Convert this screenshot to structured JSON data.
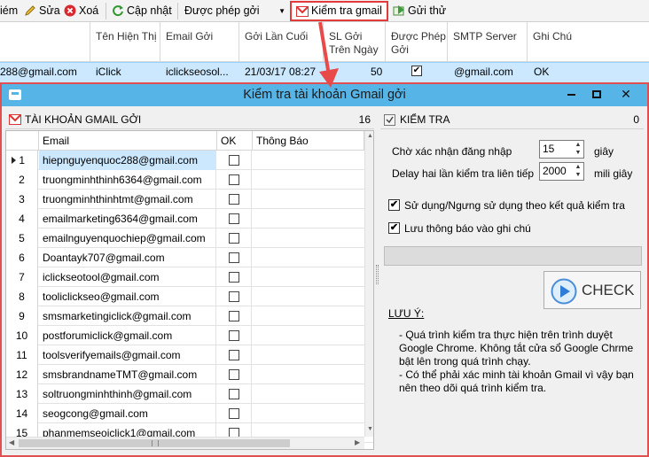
{
  "toolbar": {
    "add_label": "iém",
    "edit_label": "Sửa",
    "delete_label": "Xoá",
    "update_label": "Cập nhật",
    "filter_value": "Được phép gởi",
    "check_gmail_label": "Kiểm tra gmail",
    "send_test_label": "Gửi thử"
  },
  "bg_table": {
    "headers": [
      "Tên Hiện Thị",
      "Email Gởi",
      "Gởi Lần Cuối",
      "SL Gởi Trên Ngày",
      "Được Phép Gởi",
      "SMTP Server",
      "Ghi Chú"
    ],
    "row": {
      "email_partial": "288@gmail.com",
      "name": "iClick",
      "sender": "iclickseosol...",
      "last_sent": "21/03/17 08:27",
      "per_day": "50",
      "allowed": true,
      "smtp": "@gmail.com",
      "note": "OK"
    }
  },
  "dialog": {
    "title": "Kiểm tra tài khoản Gmail gởi",
    "left": {
      "title": "TÀI KHOẢN GMAIL GỞI",
      "count": "16",
      "columns": [
        "Email",
        "OK",
        "Thông Báo"
      ],
      "rows": [
        {
          "n": "1",
          "email": "hiepnguyenquoc288@gmail.com"
        },
        {
          "n": "2",
          "email": "truongminhthinh6364@gmail.com"
        },
        {
          "n": "3",
          "email": "truongminhthinhtmt@gmail.com"
        },
        {
          "n": "4",
          "email": "emailmarketing6364@gmail.com"
        },
        {
          "n": "5",
          "email": "emailnguyenquochiep@gmail.com"
        },
        {
          "n": "6",
          "email": "Doantayk707@gmail.com"
        },
        {
          "n": "7",
          "email": "iclickseotool@gmail.com"
        },
        {
          "n": "8",
          "email": "tooliclickseo@gmail.com"
        },
        {
          "n": "9",
          "email": "smsmarketingiclick@gmail.com"
        },
        {
          "n": "10",
          "email": "postforumiclick@gmail.com"
        },
        {
          "n": "11",
          "email": "toolsverifyemails@gmail.com"
        },
        {
          "n": "12",
          "email": "smsbrandnameTMT@gmail.com"
        },
        {
          "n": "13",
          "email": "soltruongminhthinh@gmail.com"
        },
        {
          "n": "14",
          "email": "seogcong@gmail.com"
        },
        {
          "n": "15",
          "email": "phanmemseoiclick1@gmail.com"
        }
      ]
    },
    "right": {
      "title": "KIỂM TRA",
      "count": "0",
      "confirm_label": "Chờ xác nhận đăng nhập",
      "confirm_value": "15",
      "confirm_unit": "giây",
      "delay_label": "Delay hai lần kiểm tra liên tiếp",
      "delay_value": "2000",
      "delay_unit": "mili giây",
      "opt_use_label": "Sử dụng/Ngưng sử dụng theo kết quả kiểm tra",
      "opt_use_checked": true,
      "opt_save_label": "Lưu thông báo vào ghi chú",
      "opt_save_checked": true,
      "progress": 0,
      "check_label": "CHECK",
      "note_title": "LƯU Ý:",
      "note_1": "- Quá trình kiểm tra thực hiện trên trình duyệt Google Chrome. Không tắt cửa sổ Google Chrme bật lên trong quá trình chạy.",
      "note_2": "- Có thể phải xác minh tài khoản Gmail vì vậy bạn nên theo dõi quá trình kiểm tra."
    }
  }
}
